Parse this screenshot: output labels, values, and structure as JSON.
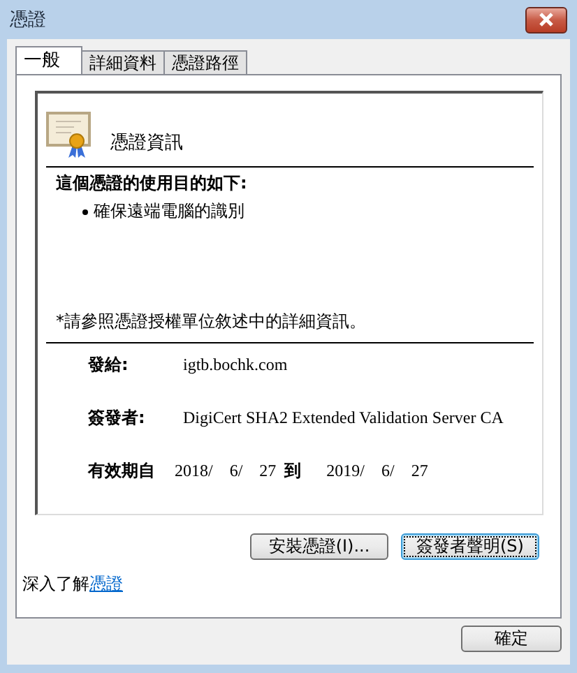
{
  "window": {
    "title": "憑證"
  },
  "tabs": [
    {
      "label": "一般",
      "selected": true
    },
    {
      "label": "詳細資料",
      "selected": false
    },
    {
      "label": "憑證路徑",
      "selected": false
    }
  ],
  "info": {
    "title": "憑證資訊",
    "purpose_heading": "這個憑證的使用目的如下:",
    "purposes": [
      "確保遠端電腦的識別"
    ],
    "note": "*請參照憑證授權單位敘述中的詳細資訊。",
    "fields": [
      {
        "label": "發給:",
        "value": "igtb.bochk.com"
      },
      {
        "label": "簽發者:",
        "value": "DigiCert SHA2 Extended Validation Server CA"
      }
    ],
    "validity": {
      "label": "有效期自",
      "from": "2018/　6/　27",
      "to_label": "到",
      "to": "2019/　6/　27"
    }
  },
  "buttons": [
    {
      "label": "安裝憑證(I)...",
      "focused": false
    },
    {
      "label": "簽發者聲明(S)",
      "focused": true
    }
  ],
  "learn_more": {
    "text": "深入了解",
    "link": "憑證"
  },
  "footer_buttons": [
    "確定"
  ]
}
